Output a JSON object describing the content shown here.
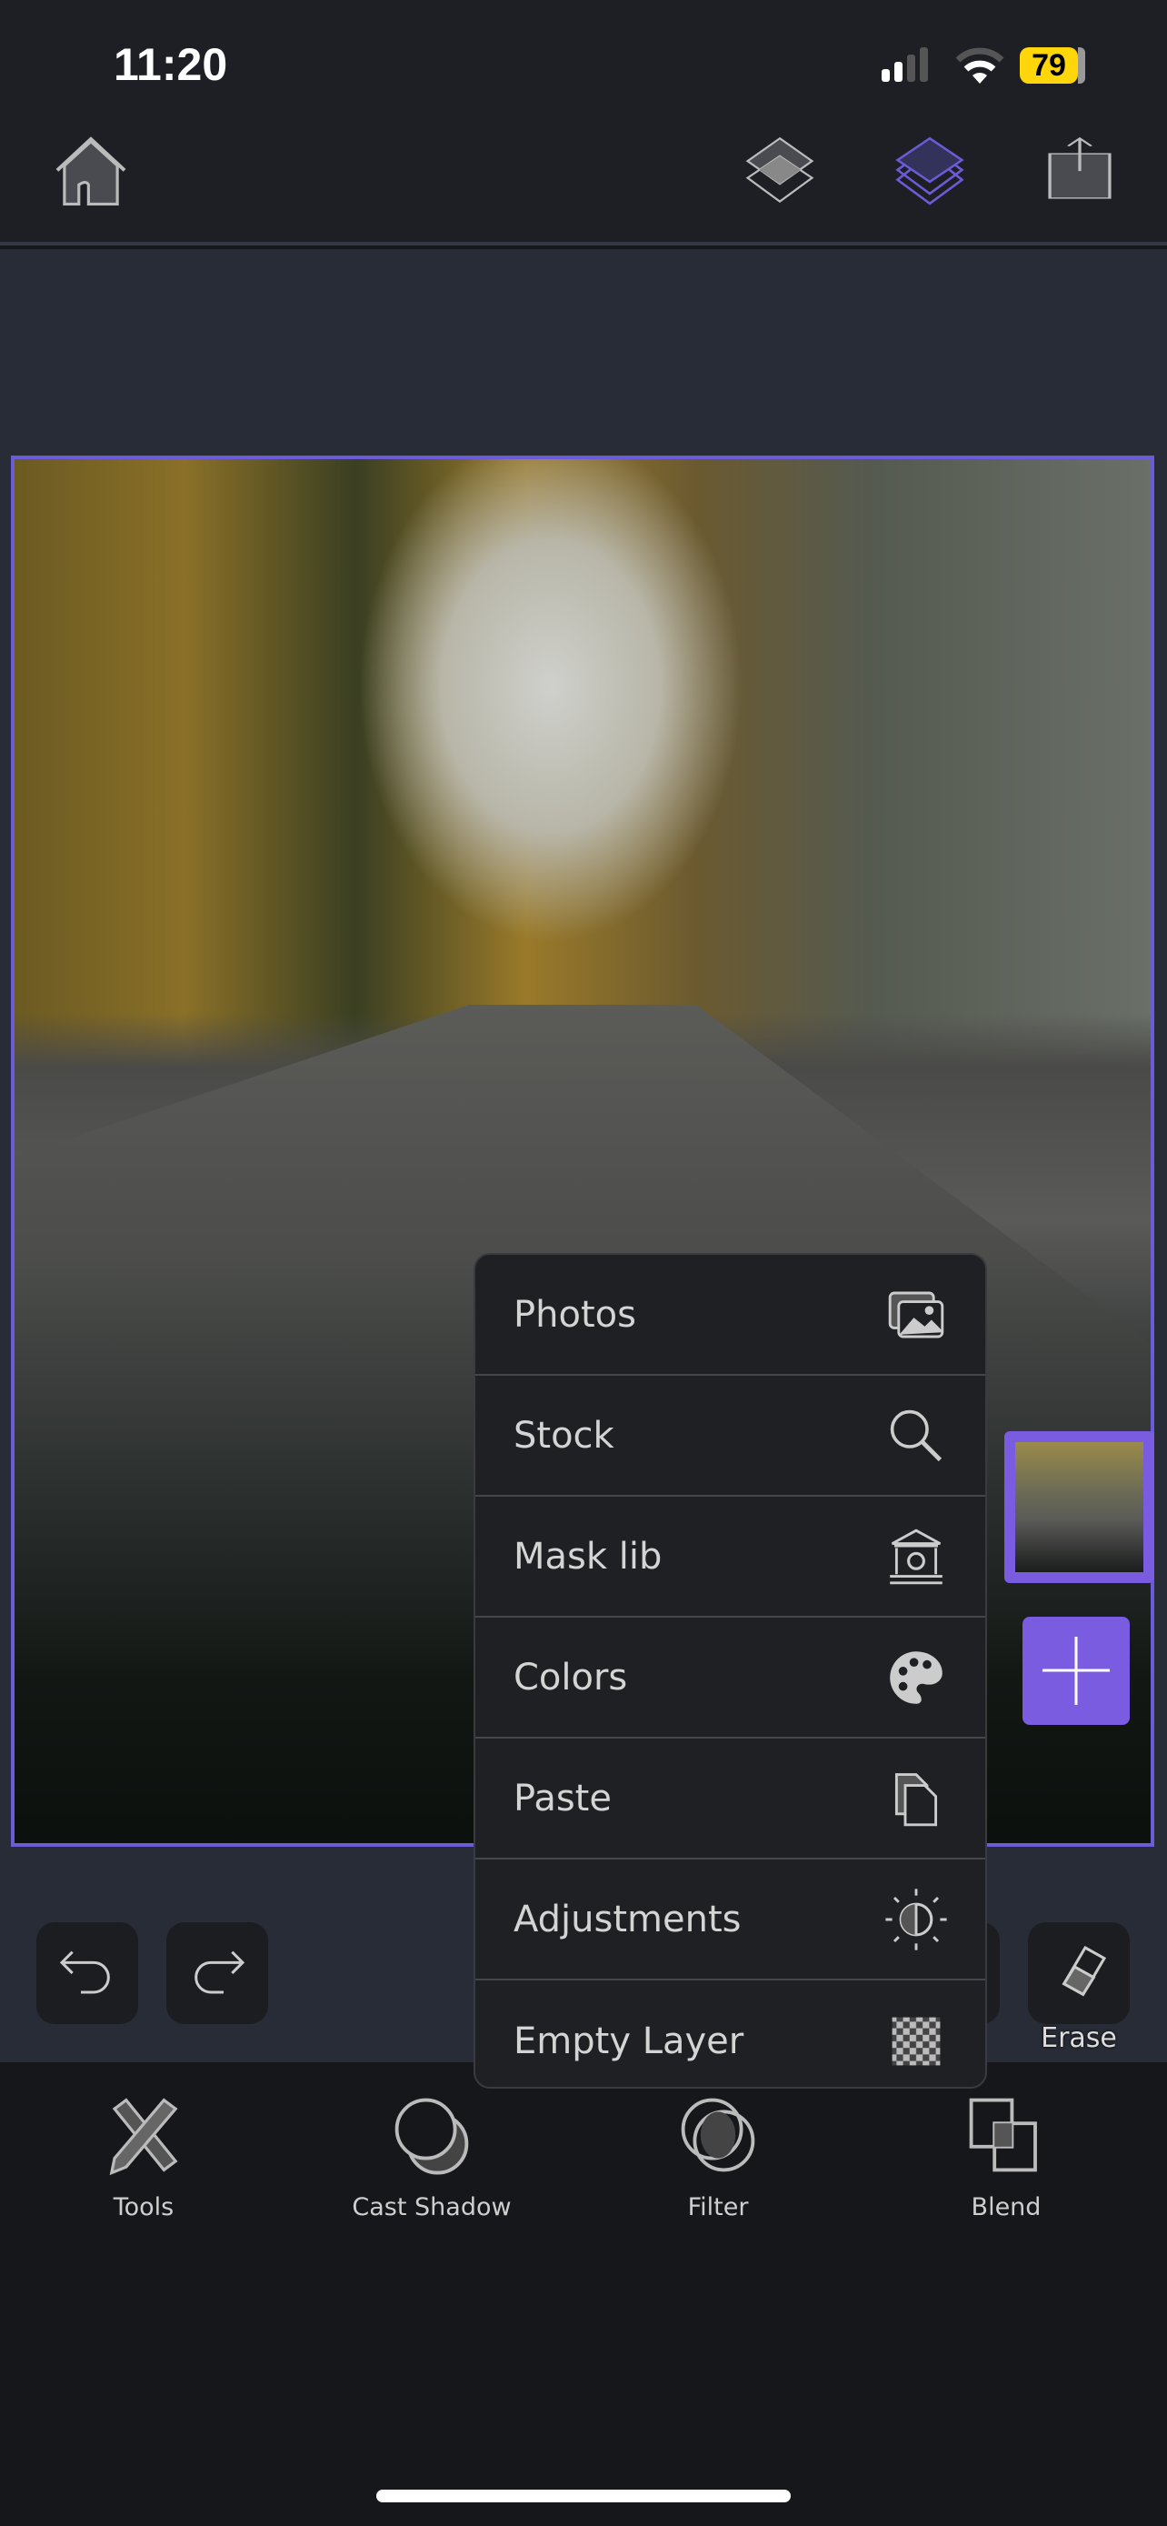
{
  "status_bar": {
    "time": "11:20",
    "battery": "79"
  },
  "nav": {
    "home": "home-icon",
    "layers_alt": "layers-icon",
    "layers_active": "layers-stack-icon",
    "share": "share-icon",
    "accent": "#6b5bd6"
  },
  "menu": {
    "items": [
      {
        "label": "Photos",
        "icon": "photos-icon"
      },
      {
        "label": "Stock",
        "icon": "search-icon"
      },
      {
        "label": "Mask lib",
        "icon": "museum-icon"
      },
      {
        "label": "Colors",
        "icon": "palette-icon"
      },
      {
        "label": "Paste",
        "icon": "paste-icon"
      },
      {
        "label": "Adjustments",
        "icon": "brightness-icon"
      },
      {
        "label": "Empty Layer",
        "icon": "checkerboard-icon"
      }
    ]
  },
  "canvas_tools": {
    "erase": "Erase"
  },
  "toolbar": {
    "items": [
      {
        "label": "Tools"
      },
      {
        "label": "Cast Shadow"
      },
      {
        "label": "Filter"
      },
      {
        "label": "Blend"
      }
    ]
  }
}
